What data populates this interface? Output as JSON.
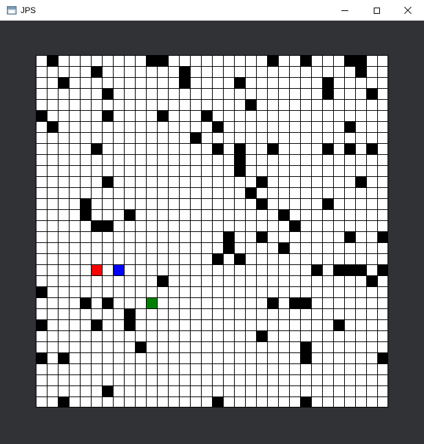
{
  "window": {
    "title": "JPS",
    "controls": [
      "minimize",
      "maximize",
      "close"
    ]
  },
  "colors": {
    "frame_background": "#313236",
    "cell_empty": "#ffffff",
    "cell_wall": "#000000",
    "grid_line": "#000000",
    "start": "#ff0000",
    "goal": "#0000ff",
    "current": "#008000"
  },
  "grid": {
    "columns": 32,
    "rows": 32,
    "walls": [
      [
        1,
        0
      ],
      [
        10,
        0
      ],
      [
        11,
        0
      ],
      [
        21,
        0
      ],
      [
        24,
        0
      ],
      [
        28,
        0
      ],
      [
        29,
        0
      ],
      [
        5,
        1
      ],
      [
        13,
        1
      ],
      [
        29,
        1
      ],
      [
        2,
        2
      ],
      [
        13,
        2
      ],
      [
        18,
        2
      ],
      [
        26,
        2
      ],
      [
        6,
        3
      ],
      [
        26,
        3
      ],
      [
        30,
        3
      ],
      [
        19,
        4
      ],
      [
        0,
        5
      ],
      [
        6,
        5
      ],
      [
        11,
        5
      ],
      [
        15,
        5
      ],
      [
        1,
        6
      ],
      [
        16,
        6
      ],
      [
        28,
        6
      ],
      [
        14,
        7
      ],
      [
        5,
        8
      ],
      [
        16,
        8
      ],
      [
        18,
        8
      ],
      [
        21,
        8
      ],
      [
        26,
        8
      ],
      [
        28,
        8
      ],
      [
        30,
        8
      ],
      [
        18,
        9
      ],
      [
        18,
        10
      ],
      [
        6,
        11
      ],
      [
        20,
        11
      ],
      [
        29,
        11
      ],
      [
        19,
        12
      ],
      [
        4,
        13
      ],
      [
        20,
        13
      ],
      [
        26,
        13
      ],
      [
        4,
        14
      ],
      [
        8,
        14
      ],
      [
        22,
        14
      ],
      [
        5,
        15
      ],
      [
        6,
        15
      ],
      [
        23,
        15
      ],
      [
        17,
        16
      ],
      [
        20,
        16
      ],
      [
        28,
        16
      ],
      [
        31,
        16
      ],
      [
        17,
        17
      ],
      [
        22,
        17
      ],
      [
        16,
        18
      ],
      [
        18,
        18
      ],
      [
        25,
        19
      ],
      [
        27,
        19
      ],
      [
        28,
        19
      ],
      [
        29,
        19
      ],
      [
        31,
        19
      ],
      [
        11,
        20
      ],
      [
        30,
        20
      ],
      [
        0,
        21
      ],
      [
        4,
        22
      ],
      [
        6,
        22
      ],
      [
        21,
        22
      ],
      [
        23,
        22
      ],
      [
        24,
        22
      ],
      [
        8,
        23
      ],
      [
        0,
        24
      ],
      [
        5,
        24
      ],
      [
        8,
        24
      ],
      [
        27,
        24
      ],
      [
        20,
        25
      ],
      [
        9,
        26
      ],
      [
        24,
        26
      ],
      [
        0,
        27
      ],
      [
        2,
        27
      ],
      [
        24,
        27
      ],
      [
        31,
        27
      ],
      [
        6,
        30
      ],
      [
        2,
        31
      ],
      [
        16,
        31
      ],
      [
        24,
        31
      ]
    ],
    "start": [
      5,
      19
    ],
    "goal": [
      7,
      19
    ],
    "current": [
      10,
      22
    ]
  }
}
